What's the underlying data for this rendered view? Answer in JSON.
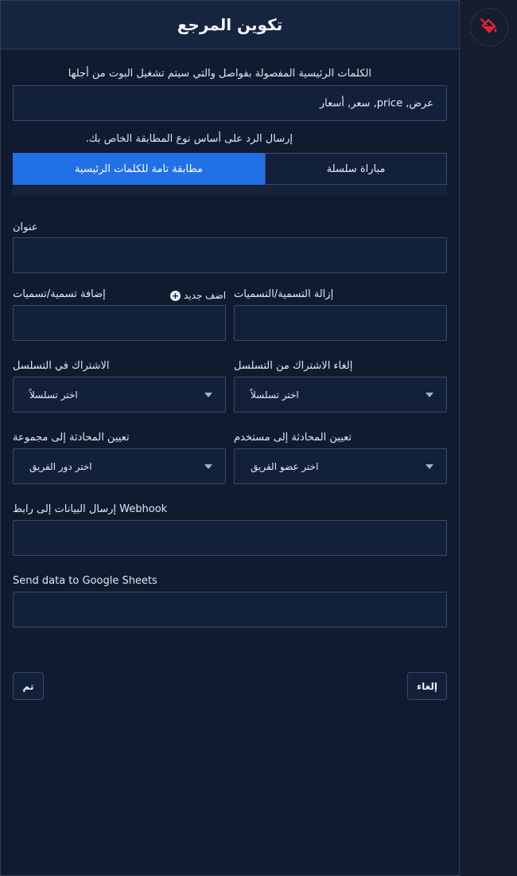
{
  "panel": {
    "title": "تكوين المرجع"
  },
  "keywords": {
    "label": "الكلمات الرئيسية المفصولة بفواصل والتي سيتم تشغيل البوت من أجلها",
    "value": "عرض, price, سعر, أسعار"
  },
  "match": {
    "label": ".إرسال الرد على أساس نوع المطابقة الخاص بك",
    "exact_label": "مطابقة تامة للكلمات الرئيسية",
    "string_label": "مباراة سلسلة",
    "selected": "exact"
  },
  "title_field": {
    "label": "عنوان",
    "value": ""
  },
  "remove_labels": {
    "label": "إزالة التسمية/التسميات",
    "value": ""
  },
  "add_labels": {
    "label": "إضافة تسمية/تسميات",
    "add_new": "اضف جديد",
    "value": ""
  },
  "unsubscribe_sequence": {
    "label": "إلغاء الاشتراك من التسلسل",
    "selected": "اختر تسلسلاً"
  },
  "subscribe_sequence": {
    "label": "الاشتراك في التسلسل",
    "selected": "اختر تسلسلاً"
  },
  "assign_user": {
    "label": "تعيين المحادثة إلى مستخدم",
    "selected": "اختر عضو الفريق"
  },
  "assign_group": {
    "label": "تعيين المحادثة إلى مجموعة",
    "selected": "اختر دور الفريق"
  },
  "webhook": {
    "label": "إرسال البيانات إلى رابط Webhook",
    "value": ""
  },
  "google_sheets": {
    "label": "Send data to Google Sheets",
    "value": ""
  },
  "actions": {
    "cancel_label": "إلغاء",
    "done_label": "تم"
  },
  "colors": {
    "accent": "#2270e6",
    "panel_bg": "#101b30",
    "logo_red": "#e0243c"
  },
  "icons": {
    "logo": "paint-bucket-icon",
    "add": "plus-circle-icon",
    "caret": "chevron-down-icon"
  }
}
